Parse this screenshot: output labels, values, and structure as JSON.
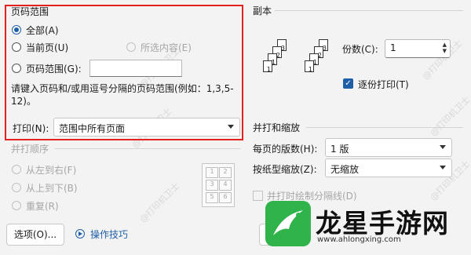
{
  "page_range": {
    "group_title": "页码范围",
    "all_label": "全部(A)",
    "current_page_label": "当前页(U)",
    "selection_label": "所选内容(E)",
    "pages_label": "页码范围(G):",
    "pages_value": "",
    "hint_text": "请键入页码和/或用逗号分隔的页码范围(例如：1,3,5-12)。",
    "print_label": "打印(N):",
    "print_value": "范围中所有页面"
  },
  "copies": {
    "group_title": "副本",
    "count_label": "份数(C):",
    "count_value": "1",
    "collate_label": "逐份打印(T)",
    "collate_checked": true,
    "stack_numbers": [
      "3",
      "2",
      "1"
    ]
  },
  "collate_order": {
    "group_title": "并打顺序",
    "left_to_right_label": "从左到右(F)",
    "top_to_bottom_label": "从上到下(B)",
    "repeat_label": "重复(R)",
    "preview_numbers": [
      "1",
      "2",
      "3",
      "4",
      "5",
      "6"
    ]
  },
  "zoom": {
    "group_title": "并打和缩放",
    "pages_per_sheet_label": "每页的版数(H):",
    "pages_per_sheet_value": "1 版",
    "scale_label": "按纸型缩放(Z):",
    "scale_value": "无缩放",
    "draw_border_label": "并打时绘制分隔线(D)"
  },
  "footer": {
    "options_button": "选项(O)...",
    "tips_link": "操作技巧"
  },
  "watermark": {
    "text": "@打印机卫士",
    "brand_name": "龙星手游网",
    "brand_url": "www.ahlongxing.com"
  },
  "colors": {
    "highlight": "#e4221f",
    "accent": "#1f5fa8",
    "logo_green": "#2fb34a"
  }
}
